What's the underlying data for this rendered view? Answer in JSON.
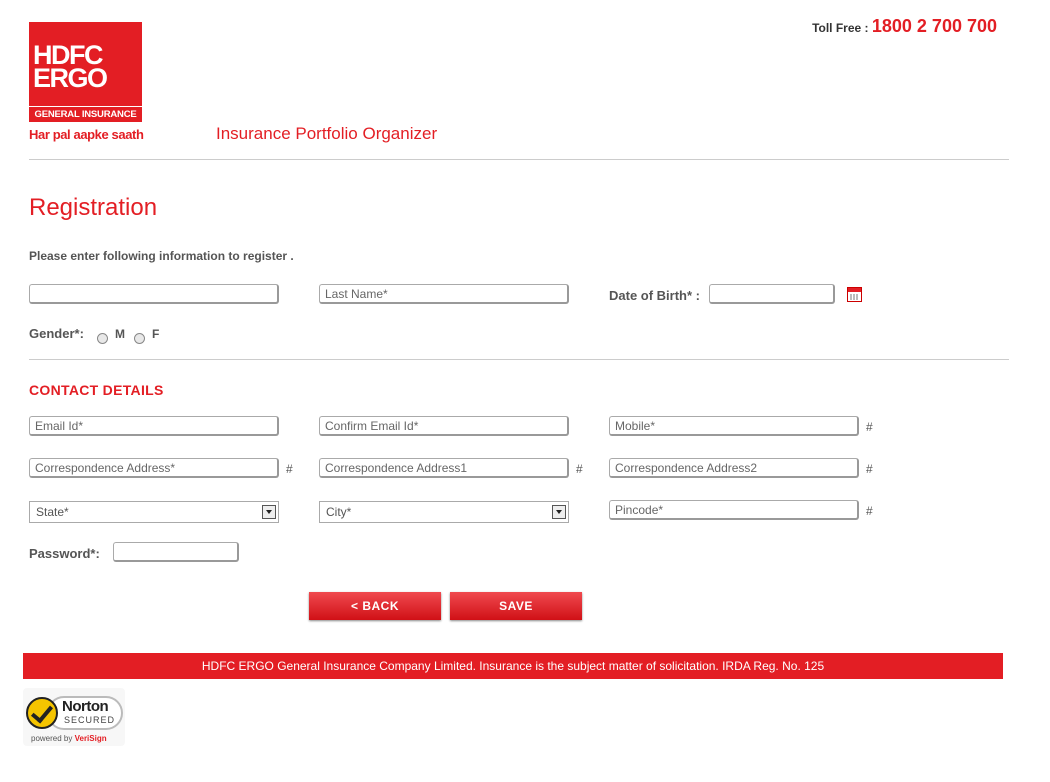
{
  "header": {
    "logo": {
      "line1": "HDFC",
      "line2": "ERGO",
      "line3": "GENERAL INSURANCE"
    },
    "tagline": "Har pal aapke saath",
    "portal_title": "Insurance Portfolio Organizer",
    "toll_free_label": "Toll Free :",
    "toll_free_number": "1800 2 700 700"
  },
  "page": {
    "heading": "Registration",
    "intro": "Please enter following information to register ."
  },
  "personal": {
    "first_name": {
      "value": "",
      "placeholder": ""
    },
    "last_name": {
      "value": "Last Name*"
    },
    "dob_label": "Date of Birth* :",
    "dob": {
      "value": ""
    },
    "gender_label": "Gender*:",
    "gender_m": "M",
    "gender_f": "F"
  },
  "contact": {
    "section_title": "CONTACT DETAILS",
    "email": "Email Id*",
    "confirm_email": "Confirm Email Id*",
    "mobile": "Mobile*",
    "address": "Correspondence Address*",
    "address1": "Correspondence Address1",
    "address2": "Correspondence Address2",
    "state": "State*",
    "city": "City*",
    "pincode": "Pincode*",
    "hash": "#",
    "password_label": "Password*:",
    "password": ""
  },
  "buttons": {
    "back": "<  BACK",
    "save": "SAVE"
  },
  "footer": {
    "text": "HDFC ERGO General Insurance Company Limited. Insurance is the subject matter of solicitation. IRDA Reg. No. 125"
  },
  "norton": {
    "brand": "Norton",
    "secured": "SECURED",
    "powered": "powered by",
    "powered_brand": "VeriSign"
  },
  "colors": {
    "brand_red": "#e31e24",
    "text_gray": "#555555",
    "divider": "#cccccc"
  },
  "icons": {
    "calendar": "calendar-icon",
    "select_arrow": "chevron-down-icon",
    "norton_check": "checkmark-icon"
  }
}
